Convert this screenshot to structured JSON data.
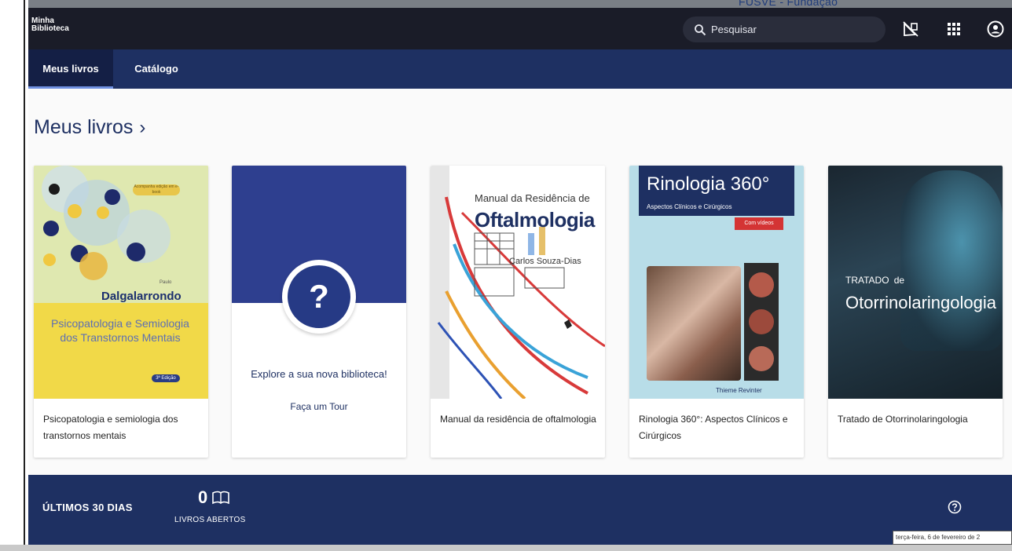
{
  "background": {
    "partial_text": "FUSVE - Fundação"
  },
  "header": {
    "logo_line1": "Minha",
    "logo_line2": "Biblioteca",
    "search_placeholder": "Pesquisar",
    "icons": [
      "search-icon",
      "no-signal-icon",
      "apps-grid-icon",
      "account-icon"
    ]
  },
  "nav": {
    "tabs": [
      {
        "label": "Meus livros",
        "active": true
      },
      {
        "label": "Catálogo",
        "active": false
      }
    ]
  },
  "section": {
    "title": "Meus livros",
    "chevron": "›"
  },
  "books": [
    {
      "title": "Psicopatologia e semiologia dos transtornos mentais",
      "cover_author_prefix": "Paulo",
      "cover_author": "Dalgalarrondo",
      "cover_title": "Psicopatologia e Semiologia dos Transtornos Mentais",
      "cover_badge": "3ª Edição"
    },
    {
      "title": "",
      "tour_heading": "Explore a sua nova biblioteca!",
      "tour_link": "Faça um Tour",
      "icon": "question-icon"
    },
    {
      "title": "Manual da residência de oftalmologia",
      "cover_line1": "Manual da Residência de",
      "cover_line2": "Oftalmologia",
      "cover_author": "Carlos Souza-Dias"
    },
    {
      "title": "Rinologia 360°: Aspectos Clínicos e Cirúrgicos",
      "cover_title": "Rinologia 360°",
      "cover_subtitle": "Aspectos Clínicos e Cirúrgicos",
      "cover_tag": "Com vídeos",
      "cover_publisher": "Thieme Revinter"
    },
    {
      "title": "Tratado de Otorrinolaringologia",
      "cover_line1": "TRATADO",
      "cover_line1_small": "de",
      "cover_line2": "Otorrinolaringologia"
    }
  ],
  "footer": {
    "period_label": "ÚLTIMOS 30 DIAS",
    "count": "0",
    "count_label": "LIVROS ABERTOS",
    "help_icon": "help-circle-icon"
  },
  "tooltip": "terça-feira, 6 de fevereiro de 2"
}
